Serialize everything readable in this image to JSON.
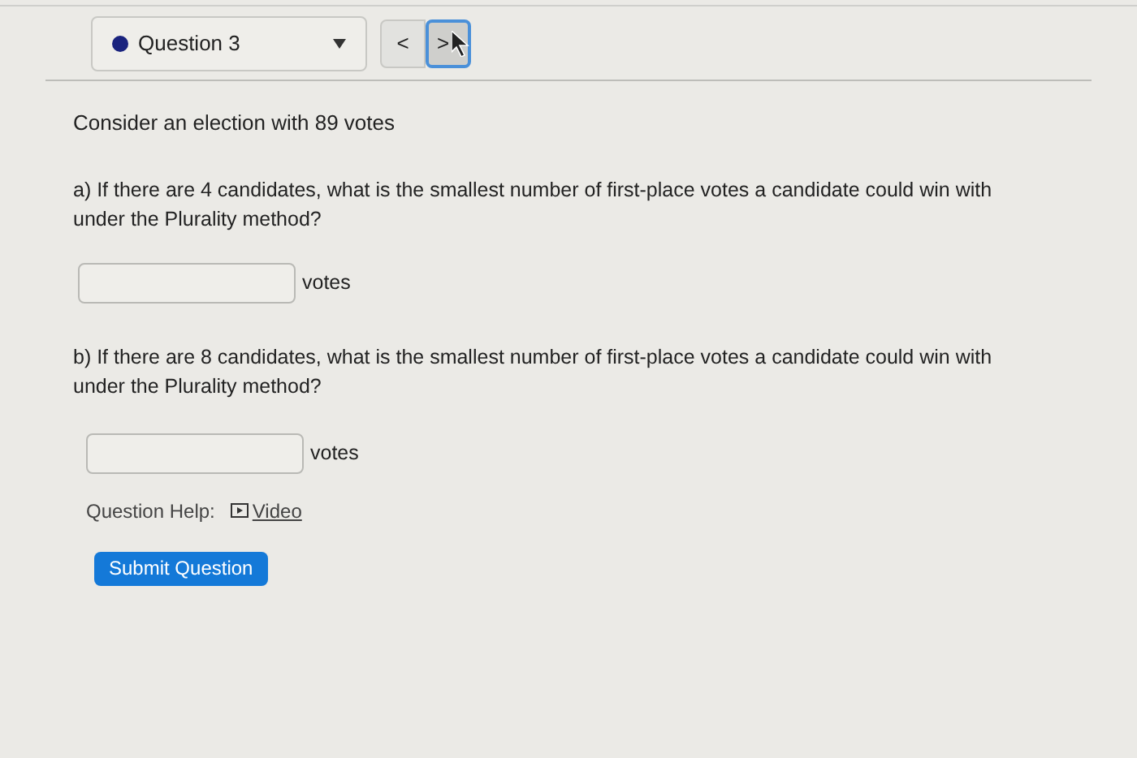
{
  "question_selector": {
    "label": "Question 3"
  },
  "nav": {
    "previous": "<",
    "next": ">"
  },
  "intro": "Consider an election with 89 votes",
  "parts": [
    {
      "question": "a) If there are 4 candidates, what is the smallest number of first-place votes a candidate could win with under the Plurality method?",
      "unit": "votes"
    },
    {
      "question": "b) If there are 8 candidates, what is the smallest number of first-place votes a candidate could win with under the Plurality method?",
      "unit": "votes"
    }
  ],
  "help": {
    "label": "Question Help:",
    "link": "Video"
  },
  "submit": "Submit Question"
}
